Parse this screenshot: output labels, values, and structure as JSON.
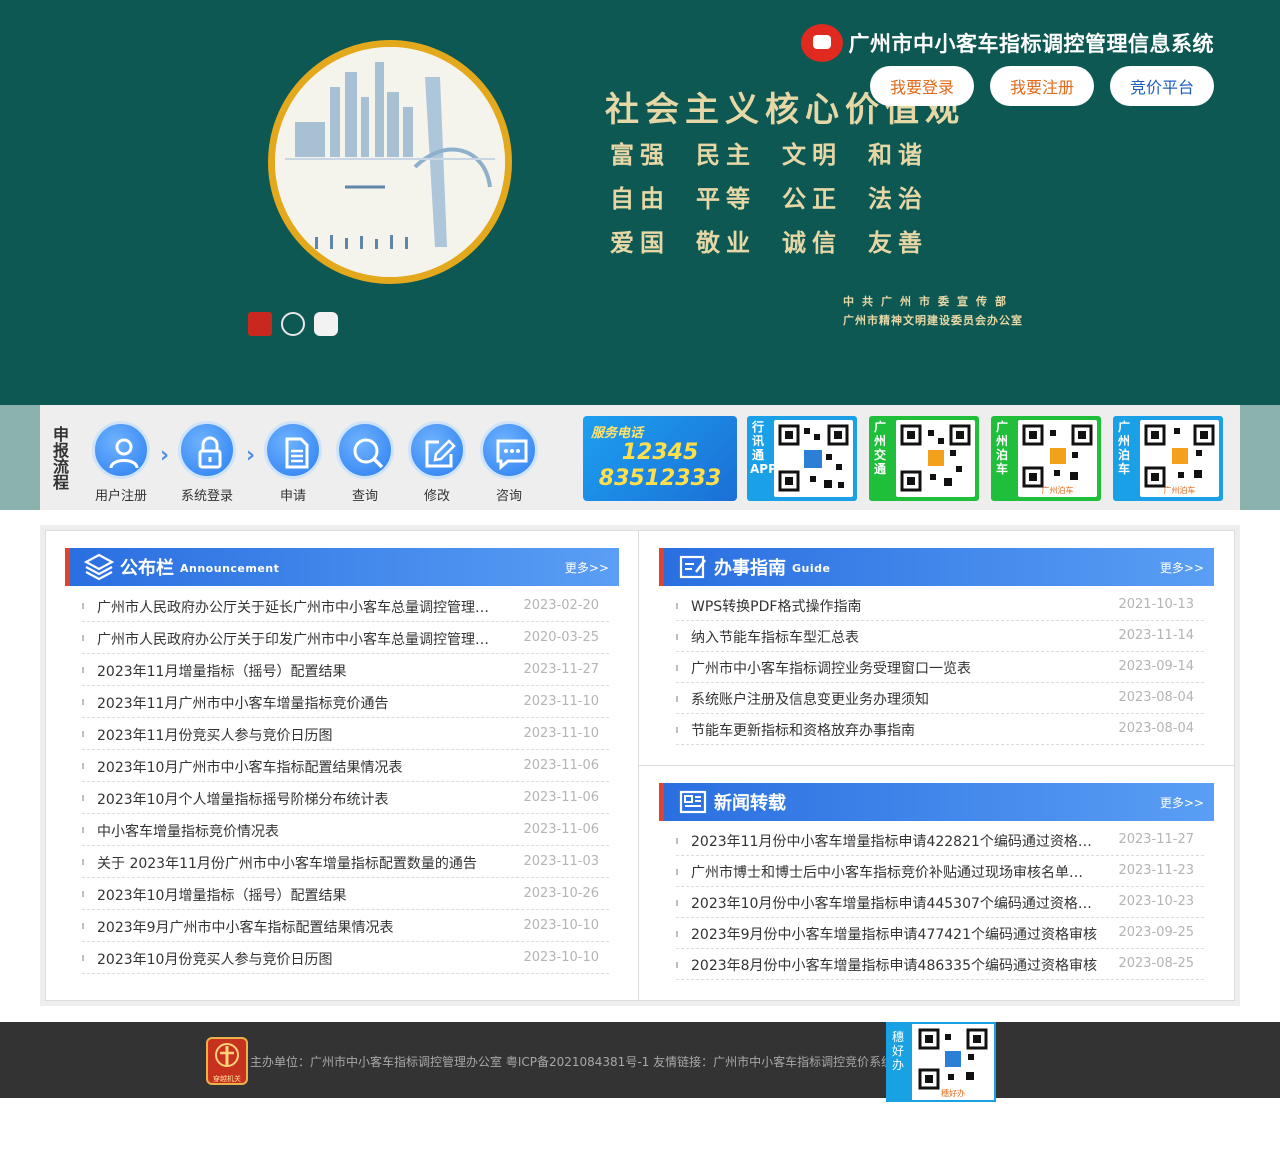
{
  "header": {
    "system_name": "广州市中小客车指标调控管理信息系统",
    "buttons": {
      "login": "我要登录",
      "register": "我要注册",
      "bidding": "竞价平台"
    }
  },
  "banner": {
    "title": "社会主义核心价值观",
    "values": [
      "富强",
      "民主",
      "文明",
      "和谐",
      "自由",
      "平等",
      "公正",
      "法治",
      "爱国",
      "敬业",
      "诚信",
      "友善"
    ],
    "issuers": [
      "中共广州市委宣传部",
      "广州市精神文明建设委员会办公室"
    ]
  },
  "process": {
    "label": "申报流程",
    "steps": [
      "用户注册",
      "系统登录",
      "申请",
      "查询",
      "修改",
      "咨询"
    ],
    "chevron": "›",
    "hotline": {
      "caption": "服务电话",
      "number1": "12345",
      "number2": "83512333"
    },
    "qr_cards": [
      {
        "tag": "行讯通APP",
        "caption": ""
      },
      {
        "tag": "广州交通",
        "caption": ""
      },
      {
        "tag": "广州泊车",
        "caption": "广州泊车"
      },
      {
        "tag": "广州泊车",
        "caption": "广州泊车"
      }
    ]
  },
  "announcement": {
    "title": "公布栏",
    "en": "Announcement",
    "more": "更多>>",
    "items": [
      {
        "title": "广州市人民政府办公厅关于延长广州市中小客车总量调控管理…",
        "date": "2023-02-20"
      },
      {
        "title": "广州市人民政府办公厅关于印发广州市中小客车总量调控管理…",
        "date": "2020-03-25"
      },
      {
        "title": "2023年11月增量指标（摇号）配置结果",
        "date": "2023-11-27"
      },
      {
        "title": "2023年11月广州市中小客车增量指标竞价通告",
        "date": "2023-11-10"
      },
      {
        "title": "2023年11月份竞买人参与竞价日历图",
        "date": "2023-11-10"
      },
      {
        "title": "2023年10月广州市中小客车指标配置结果情况表",
        "date": "2023-11-06"
      },
      {
        "title": "2023年10月个人增量指标摇号阶梯分布统计表",
        "date": "2023-11-06"
      },
      {
        "title": "中小客车增量指标竞价情况表",
        "date": "2023-11-06"
      },
      {
        "title": "关于 2023年11月份广州市中小客车增量指标配置数量的通告",
        "date": "2023-11-03"
      },
      {
        "title": "2023年10月增量指标（摇号）配置结果",
        "date": "2023-10-26"
      },
      {
        "title": "2023年9月广州市中小客车指标配置结果情况表",
        "date": "2023-10-10"
      },
      {
        "title": "2023年10月份竞买人参与竞价日历图",
        "date": "2023-10-10"
      }
    ]
  },
  "guide": {
    "title": "办事指南",
    "en": "Guide",
    "more": "更多>>",
    "items": [
      {
        "title": "WPS转换PDF格式操作指南",
        "date": "2021-10-13"
      },
      {
        "title": "纳入节能车指标车型汇总表",
        "date": "2023-11-14"
      },
      {
        "title": "广州市中小客车指标调控业务受理窗口一览表",
        "date": "2023-09-14"
      },
      {
        "title": "系统账户注册及信息变更业务办理须知",
        "date": "2023-08-04"
      },
      {
        "title": "节能车更新指标和资格放弃办事指南",
        "date": "2023-08-04"
      }
    ]
  },
  "news": {
    "title": "新闻转载",
    "more": "更多>>",
    "items": [
      {
        "title": "2023年11月份中小客车增量指标申请422821个编码通过资格…",
        "date": "2023-11-27"
      },
      {
        "title": "广州市博士和博士后中小客车指标竞价补贴通过现场审核名单…",
        "date": "2023-11-23"
      },
      {
        "title": "2023年10月份中小客车增量指标申请445307个编码通过资格…",
        "date": "2023-10-23"
      },
      {
        "title": "2023年9月份中小客车增量指标申请477421个编码通过资格审核",
        "date": "2023-09-25"
      },
      {
        "title": "2023年8月份中小客车增量指标申请486335个编码通过资格审核",
        "date": "2023-08-25"
      }
    ]
  },
  "footer": {
    "text": "主办单位：广州市中小客车指标调控管理办公室 粤ICP备2021084381号-1 友情链接：广州市中小客车指标调控竞价系统",
    "logo_caption": "穿越机关",
    "qr_tag": "穗好办",
    "qr_caption": "穗好办"
  },
  "colors": {
    "banner_bg": "#0d5852",
    "panel_header": "#2a6fe0",
    "accent_red": "#e2412a",
    "login_text": "#e26a1a",
    "footer_bg": "#333333"
  }
}
